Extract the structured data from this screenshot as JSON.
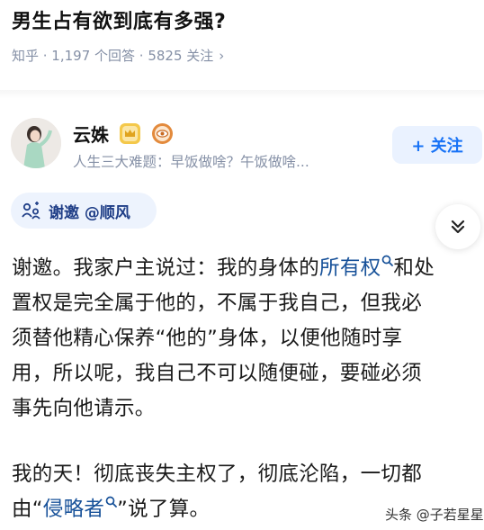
{
  "question": {
    "title": "男生占有欲到底有多强?",
    "meta": "知乎 · 1,197 个回答 · 5825 关注"
  },
  "author": {
    "name": "云姝",
    "bio": "人生三大难题：早饭做啥？午饭做啥...",
    "follow_label": "+ 关注"
  },
  "invite": {
    "label": "谢邀 @顺风"
  },
  "answer": {
    "p1": {
      "line1_start": "谢邀。我家户主说过：我的身体的",
      "line1_link": "所有权",
      "line1_end": "和处",
      "line2": "置权是完全属于他的，不属于我自己，但我必",
      "line3": "须替他精心保养“他的”身体，以便他随时享",
      "line4": "用，所以呢，我自己不可以随便碰，要碰必须",
      "line5": "事先向他请示。"
    },
    "p2": {
      "line1": "我的天！彻底丧失主权了，彻底沦陷，一切都",
      "line2_start": "由“",
      "line2_link": "侵略者",
      "line2_end": "”说了算。"
    }
  },
  "watermark": {
    "toutiao": "头条 @子若星星"
  },
  "icons": {
    "meta_chevron": "chevron-right-icon",
    "badge_1": "crown-badge-icon",
    "badge_2": "eye-badge-icon",
    "invite": "invite-icon",
    "collapse": "double-chevron-down-icon",
    "link_search": "search-icon"
  },
  "colors": {
    "link": "#175199",
    "follow_text": "#1772f6",
    "follow_bg": "#eaf2ff",
    "meta_gray": "#8590a6",
    "invite_bg": "#edf3fd"
  }
}
